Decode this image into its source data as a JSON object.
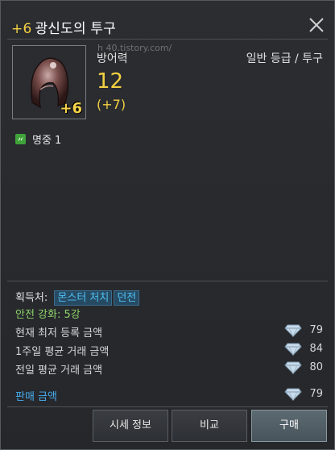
{
  "header": {
    "enhance_label": "+6",
    "item_name": "광신도의 투구"
  },
  "item": {
    "enhance_badge": "+6",
    "watermark": "h          40.tistory.com/",
    "stat_label": "방어력",
    "grade_label": "일반 등급 / 투구",
    "stat_value": "12",
    "stat_bonus": "(+7)",
    "option_text": "명중  1"
  },
  "acquire": {
    "label": "획득처:",
    "tags": [
      "몬스터 처치",
      "던전"
    ]
  },
  "safe_enhance": "안전 강화: 5강",
  "prices": [
    {
      "label": "현재 최저 등록 금액",
      "value": "79"
    },
    {
      "label": "1주일 평균 거래 금액",
      "value": "84"
    },
    {
      "label": "전일 평균 거래 금액",
      "value": "80"
    }
  ],
  "sell": {
    "label": "판매 금액",
    "value": "79"
  },
  "buttons": {
    "market": "시세 정보",
    "compare": "비교",
    "buy": "구매"
  },
  "colors": {
    "enhance": "#f2d043",
    "tag_text": "#4ec0f2",
    "safe": "#8ed36a",
    "sell_label": "#47aef0"
  },
  "icons": {
    "close": "close-icon",
    "option": "green-stat-icon",
    "currency": "diamond-icon"
  }
}
